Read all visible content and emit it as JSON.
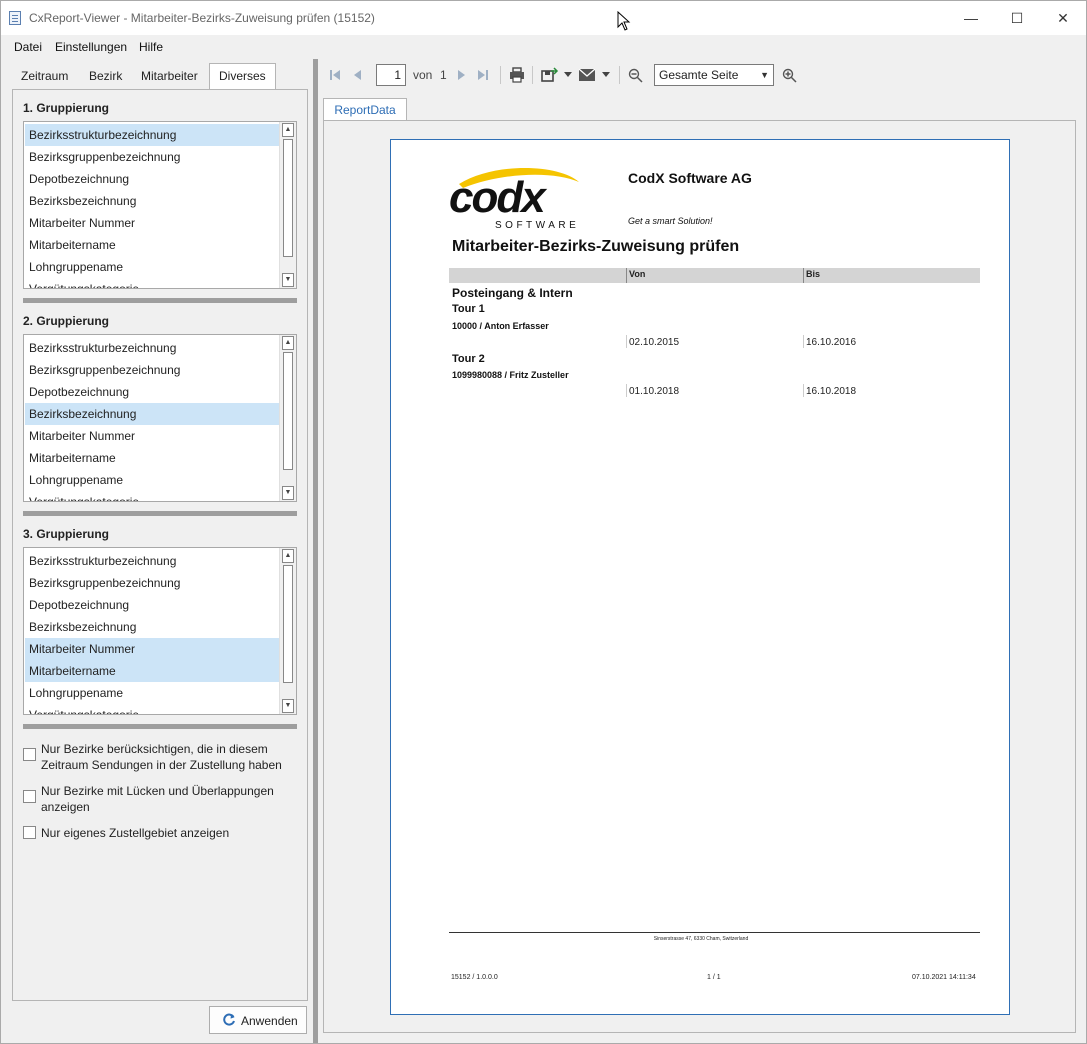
{
  "window": {
    "title": "CxReport-Viewer - Mitarbeiter-Bezirks-Zuweisung prüfen (15152)",
    "minimize": "—",
    "maximize": "☐",
    "close": "✕"
  },
  "menu": [
    "Datei",
    "Einstellungen",
    "Hilfe"
  ],
  "tabs": [
    "Zeitraum",
    "Bezirk",
    "Mitarbeiter",
    "Diverses"
  ],
  "active_tab": "Diverses",
  "groupings": [
    {
      "title": "1. Gruppierung",
      "items": [
        "Bezirksstrukturbezeichnung",
        "Bezirksgruppenbezeichnung",
        "Depotbezeichnung",
        "Bezirksbezeichnung",
        "Mitarbeiter Nummer",
        "Mitarbeitername",
        "Lohngruppename",
        "Vergütungskategorie"
      ],
      "selected": [
        0
      ]
    },
    {
      "title": "2. Gruppierung",
      "items": [
        "Bezirksstrukturbezeichnung",
        "Bezirksgruppenbezeichnung",
        "Depotbezeichnung",
        "Bezirksbezeichnung",
        "Mitarbeiter Nummer",
        "Mitarbeitername",
        "Lohngruppename",
        "Vergütungskategorie"
      ],
      "selected": [
        3
      ]
    },
    {
      "title": "3. Gruppierung",
      "items": [
        "Bezirksstrukturbezeichnung",
        "Bezirksgruppenbezeichnung",
        "Depotbezeichnung",
        "Bezirksbezeichnung",
        "Mitarbeiter Nummer",
        "Mitarbeitername",
        "Lohngruppename",
        "Vergütungskategorie"
      ],
      "selected": [
        4,
        5
      ]
    }
  ],
  "checkboxes": [
    {
      "label": "Nur Bezirke berücksichtigen, die in diesem Zeitraum Sendungen in der Zustellung haben",
      "checked": false
    },
    {
      "label": "Nur Bezirke mit Lücken und Überlappungen anzeigen",
      "checked": false
    },
    {
      "label": "Nur eigenes Zustellgebiet anzeigen",
      "checked": false
    }
  ],
  "apply_label": "Anwenden",
  "toolbar": {
    "page": "1",
    "of_label": "von",
    "total_pages": "1",
    "zoom": "Gesamte Seite"
  },
  "report_tab": "ReportData",
  "report": {
    "logo_text": "codx",
    "logo_sub": "SOFTWARE",
    "company": "CodX Software AG",
    "slogan": "Get a smart Solution!",
    "title": "Mitarbeiter-Bezirks-Zuweisung prüfen",
    "col_von": "Von",
    "col_bis": "Bis",
    "group": "Posteingang & Intern",
    "tours": [
      {
        "name": "Tour 1",
        "employee": "10000 / Anton Erfasser",
        "von": "02.10.2015",
        "bis": "16.10.2016"
      },
      {
        "name": "Tour 2",
        "employee": "1099980088 / Fritz Zusteller",
        "von": "01.10.2018",
        "bis": "16.10.2018"
      }
    ],
    "footer_address": "Sinserstrasse 47, 6330 Cham, Switzerland",
    "footer_left": "15152 / 1.0.0.0",
    "footer_center": "1 / 1",
    "footer_right": "07.10.2021 14:11:34"
  },
  "colors": {
    "selection": "#cce4f7",
    "accent": "#2f6fb5",
    "logo_yellow": "#f5c400"
  }
}
